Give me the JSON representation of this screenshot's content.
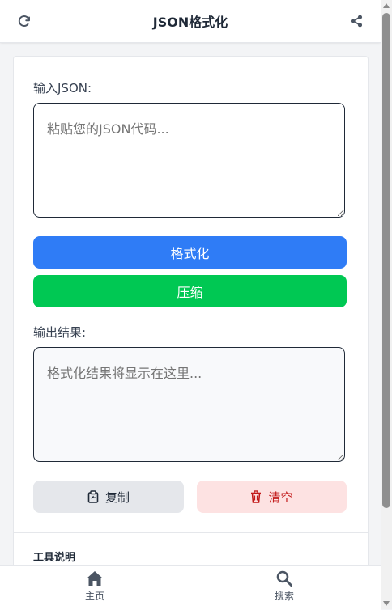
{
  "header": {
    "title": "JSON格式化",
    "left_icon": "refresh-icon",
    "right_icon": "share-icon"
  },
  "input": {
    "label": "输入JSON:",
    "placeholder": "粘贴您的JSON代码..."
  },
  "buttons": {
    "format": "格式化",
    "compress": "压缩",
    "copy": "复制",
    "clear": "清空"
  },
  "output": {
    "label": "输出结果:",
    "placeholder": "格式化结果将显示在这里..."
  },
  "tool": {
    "title": "工具说明"
  },
  "nav": {
    "home": "主页",
    "search": "搜索"
  },
  "colors": {
    "primary": "#2f7cf6",
    "success": "#00c853",
    "danger": "#c21818",
    "danger_bg": "#fde2e2"
  }
}
